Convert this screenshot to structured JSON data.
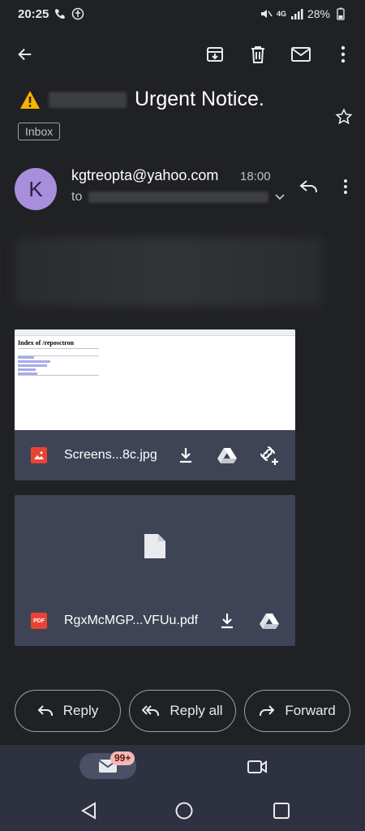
{
  "status": {
    "time": "20:25",
    "network": "4G",
    "battery": "28%"
  },
  "toolbar": {
    "icons": [
      "back-arrow-icon",
      "archive-icon",
      "delete-icon",
      "mark-unread-icon",
      "more-vert-icon"
    ]
  },
  "email": {
    "subject": "Urgent Notice.",
    "label": "Inbox",
    "sender": {
      "initial": "K",
      "address": "kgtreopta@yahoo.com",
      "time": "18:00"
    },
    "to_prefix": "to"
  },
  "attachments": [
    {
      "name": "Screens...8c.jpg",
      "type": "image",
      "preview_title": "Index of /reposctron"
    },
    {
      "name": "RgxMcMGP...VFUu.pdf",
      "type": "pdf",
      "type_label": "PDF"
    }
  ],
  "actions": {
    "reply": "Reply",
    "reply_all": "Reply all",
    "forward": "Forward"
  },
  "bottom_nav": {
    "badge": "99+"
  },
  "colors": {
    "background": "#202124",
    "card": "#3f4356",
    "avatar": "#a88fdc",
    "nav": "#2e3240",
    "badge": "#f2b8b5"
  }
}
